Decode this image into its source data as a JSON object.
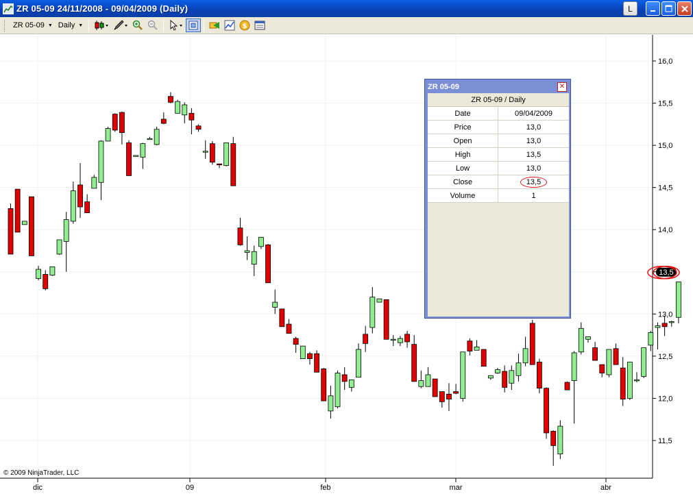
{
  "window": {
    "title": "ZR 05-09  24/11/2008 - 09/04/2009 (Daily)",
    "l_button": "L",
    "minimize_icon": "minimize-icon",
    "maximize_icon": "maximize-icon",
    "close_icon": "close-icon"
  },
  "toolbar": {
    "instrument": "ZR 05-09",
    "period": "Daily",
    "icons": [
      "candlestick-icon",
      "pencil-icon",
      "zoom-in-icon",
      "zoom-out-icon",
      "cursor-icon",
      "crosshair-icon",
      "instrument-icon",
      "indicator-icon",
      "strategy-icon",
      "data-box-icon"
    ]
  },
  "copyright": "© 2009 NinjaTrader, LLC",
  "data_box": {
    "title": "ZR 05-09",
    "header": "ZR 05-09 / Daily",
    "rows": [
      {
        "label": "Date",
        "value": "09/04/2009"
      },
      {
        "label": "Price",
        "value": "13,0"
      },
      {
        "label": "Open",
        "value": "13,0"
      },
      {
        "label": "High",
        "value": "13,5"
      },
      {
        "label": "Low",
        "value": "13,0"
      },
      {
        "label": "Close",
        "value": "13,5"
      },
      {
        "label": "Volume",
        "value": "1"
      }
    ]
  },
  "colors": {
    "up_candle": "#90ee90",
    "down_candle": "#e00000",
    "grid": "#f0f0f0",
    "annotation": "#e01010",
    "price_marker": "#000000"
  },
  "chart_data": {
    "type": "candlestick",
    "y_ticks": [
      "16,0",
      "15,5",
      "15,0",
      "14,5",
      "14,0",
      "13,5",
      "13,0",
      "12,5",
      "12,0",
      "11,5"
    ],
    "y_tick_values": [
      16.0,
      15.5,
      15.0,
      14.5,
      14.0,
      13.5,
      13.0,
      12.5,
      12.0,
      11.5
    ],
    "x_labels": [
      "dic",
      "09",
      "feb",
      "mar",
      "abr"
    ],
    "x_label_index": [
      4,
      27,
      47,
      66,
      88
    ],
    "ylim": [
      11.0,
      16.25
    ],
    "current_price_label": "13,5",
    "current_price": 13.5,
    "annotated_level": 13.5,
    "candles": [
      [
        14.25,
        13.71,
        14.31,
        13.71
      ],
      [
        14.48,
        13.97,
        14.48,
        13.97
      ],
      [
        14.06,
        14.1,
        14.1,
        14.06
      ],
      [
        14.39,
        13.69,
        14.39,
        13.69
      ],
      [
        13.42,
        13.53,
        13.57,
        13.4
      ],
      [
        13.47,
        13.3,
        13.52,
        13.28
      ],
      [
        13.46,
        13.56,
        13.56,
        13.45
      ],
      [
        13.71,
        13.88,
        13.88,
        13.7
      ],
      [
        13.86,
        14.12,
        14.21,
        13.5
      ],
      [
        14.1,
        14.46,
        14.57,
        14.07
      ],
      [
        14.53,
        14.27,
        14.79,
        14.14
      ],
      [
        14.33,
        14.2,
        14.42,
        14.2
      ],
      [
        14.49,
        14.62,
        14.65,
        14.49
      ],
      [
        14.56,
        15.05,
        15.06,
        14.35
      ],
      [
        15.05,
        15.2,
        15.22,
        15.18
      ],
      [
        15.37,
        15.18,
        15.38,
        15.16
      ],
      [
        15.39,
        15.15,
        15.4,
        15.01
      ],
      [
        15.03,
        14.64,
        15.06,
        14.64
      ],
      [
        14.88,
        14.88,
        14.88,
        14.88
      ],
      [
        14.86,
        15.02,
        15.03,
        14.72
      ],
      [
        15.08,
        15.08,
        15.1,
        15.08
      ],
      [
        15.01,
        15.19,
        15.22,
        15.0
      ],
      [
        15.31,
        15.26,
        15.39,
        15.25
      ],
      [
        15.58,
        15.51,
        15.63,
        15.5
      ],
      [
        15.38,
        15.52,
        15.54,
        15.38
      ],
      [
        15.36,
        15.48,
        15.51,
        15.26
      ],
      [
        15.38,
        15.3,
        15.44,
        15.13
      ],
      [
        15.23,
        15.19,
        15.25,
        15.16
      ],
      [
        14.92,
        14.93,
        15.06,
        14.84
      ],
      [
        15.02,
        14.8,
        15.05,
        14.77
      ],
      [
        14.78,
        14.77,
        14.78,
        14.73
      ],
      [
        14.76,
        15.03,
        15.03,
        14.75
      ],
      [
        15.02,
        14.52,
        15.1,
        14.52
      ],
      [
        14.02,
        13.82,
        14.14,
        13.81
      ],
      [
        13.73,
        13.75,
        13.92,
        13.64
      ],
      [
        13.59,
        13.74,
        13.81,
        13.45
      ],
      [
        13.8,
        13.91,
        13.89,
        13.77
      ],
      [
        13.82,
        13.37,
        13.83,
        13.37
      ],
      [
        13.08,
        13.14,
        13.29,
        13.0
      ],
      [
        13.06,
        12.85,
        13.04,
        12.85
      ],
      [
        12.88,
        12.77,
        12.94,
        12.77
      ],
      [
        12.71,
        12.64,
        12.73,
        12.54
      ],
      [
        12.47,
        12.62,
        12.62,
        12.47
      ],
      [
        12.53,
        12.47,
        12.55,
        12.4
      ],
      [
        12.53,
        12.31,
        12.57,
        12.31
      ],
      [
        12.35,
        11.97,
        12.36,
        11.97
      ],
      [
        11.85,
        12.03,
        12.15,
        11.76
      ],
      [
        11.9,
        12.3,
        12.33,
        11.88
      ],
      [
        12.28,
        12.2,
        12.37,
        12.1
      ],
      [
        12.13,
        12.22,
        12.17,
        12.08
      ],
      [
        12.25,
        12.58,
        12.65,
        12.28
      ],
      [
        12.76,
        12.65,
        12.86,
        12.55
      ],
      [
        12.84,
        13.2,
        13.32,
        12.77
      ],
      [
        13.14,
        13.18,
        13.16,
        13.16
      ],
      [
        13.17,
        12.7,
        13.17,
        12.7
      ],
      [
        12.7,
        12.7,
        12.75,
        12.62
      ],
      [
        12.66,
        12.71,
        12.74,
        12.62
      ],
      [
        12.76,
        12.67,
        12.8,
        12.6
      ],
      [
        12.64,
        12.2,
        12.75,
        12.22
      ],
      [
        12.14,
        12.21,
        12.33,
        12.12
      ],
      [
        12.14,
        12.28,
        12.37,
        12.18
      ],
      [
        12.23,
        12.02,
        12.22,
        12.02
      ],
      [
        12.08,
        11.96,
        12.08,
        11.89
      ],
      [
        12.05,
        11.99,
        12.18,
        11.85
      ],
      [
        12.08,
        12.06,
        12.17,
        12.05
      ],
      [
        12.0,
        12.55,
        12.55,
        11.96
      ],
      [
        12.68,
        12.56,
        12.71,
        12.51
      ],
      [
        12.57,
        12.61,
        12.69,
        12.57
      ],
      [
        12.58,
        12.38,
        12.58,
        12.38
      ],
      [
        12.24,
        12.27,
        12.25,
        12.22
      ],
      [
        12.3,
        12.34,
        12.36,
        12.29
      ],
      [
        12.32,
        12.13,
        12.39,
        12.07
      ],
      [
        12.18,
        12.33,
        12.39,
        12.1
      ],
      [
        12.27,
        12.42,
        12.53,
        12.2
      ],
      [
        12.42,
        12.59,
        12.73,
        12.38
      ],
      [
        12.89,
        12.4,
        12.93,
        12.4
      ],
      [
        12.43,
        12.12,
        12.47,
        12.06
      ],
      [
        12.12,
        11.59,
        12.13,
        11.52
      ],
      [
        11.61,
        11.44,
        11.62,
        11.2
      ],
      [
        11.34,
        11.67,
        11.74,
        11.28
      ],
      [
        12.19,
        12.1,
        12.2,
        12.14
      ],
      [
        12.21,
        12.54,
        12.56,
        11.7
      ],
      [
        12.55,
        12.83,
        12.9,
        12.52
      ],
      [
        12.7,
        12.73,
        12.73,
        12.66
      ],
      [
        12.6,
        12.45,
        12.67,
        12.45
      ],
      [
        12.4,
        12.3,
        12.36,
        12.25
      ],
      [
        12.28,
        12.58,
        12.58,
        12.25
      ],
      [
        12.59,
        12.4,
        12.65,
        12.4
      ],
      [
        12.36,
        11.99,
        12.49,
        11.91
      ],
      [
        12.0,
        12.43,
        12.43,
        11.98
      ],
      [
        12.22,
        12.22,
        12.31,
        12.19
      ],
      [
        12.26,
        12.6,
        12.6,
        12.24
      ],
      [
        12.63,
        12.78,
        12.8,
        12.56
      ],
      [
        12.84,
        12.86,
        12.9,
        12.58
      ],
      [
        12.89,
        12.85,
        12.98,
        12.74
      ],
      [
        12.91,
        12.91,
        12.92,
        12.85
      ],
      [
        12.96,
        13.38,
        13.38,
        12.89
      ]
    ]
  }
}
